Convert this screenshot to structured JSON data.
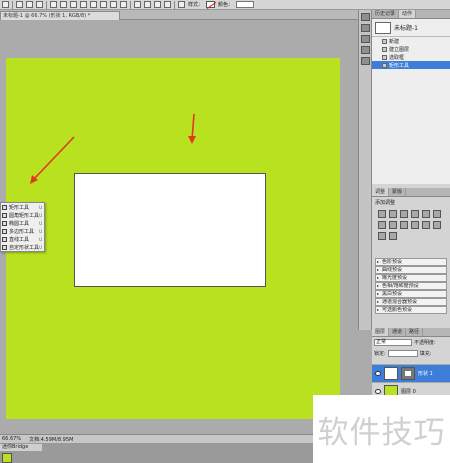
{
  "toolbar": {
    "style_label": "样式：",
    "color_label": "颜色："
  },
  "document": {
    "tab_title": "未标题-1 @ 66.7% (形状 1, RGB/8) *"
  },
  "flyout": {
    "items": [
      {
        "label": "矩形工具",
        "key": "U"
      },
      {
        "label": "圆角矩形工具",
        "key": "U"
      },
      {
        "label": "椭圆工具",
        "key": "U"
      },
      {
        "label": "多边形工具",
        "key": "U"
      },
      {
        "label": "直线工具",
        "key": "U"
      },
      {
        "label": "自定形状工具",
        "key": "U"
      }
    ]
  },
  "history": {
    "tabs": [
      "历史记录",
      "动作"
    ],
    "snapshot": "未标题-1",
    "items": [
      "新建",
      "建立图层",
      "选取框",
      "矩形工具"
    ],
    "selected_index": 3
  },
  "adjustments": {
    "tabs": [
      "调整",
      "蒙版"
    ],
    "title": "添加调整",
    "presets": [
      "色阶预设",
      "曲线预设",
      "曝光度预设",
      "色相/饱和度预设",
      "黑白预设",
      "通道混合器预设",
      "可选颜色预设"
    ]
  },
  "layers": {
    "tabs": [
      "图层",
      "通道",
      "路径"
    ],
    "blend_mode": "正常",
    "opacity_label": "不透明度:",
    "lock_label": "锁定:",
    "fill_label": "填充:",
    "rows": [
      {
        "name": "形状 1",
        "active": true
      },
      {
        "name": "图层 0",
        "active": false
      }
    ]
  },
  "status": {
    "zoom": "66.67%",
    "doc": "文档:4.59M/8.95M"
  },
  "bottom": {
    "tab": "迷你Bridge"
  },
  "watermark": {
    "text": "软件技巧"
  },
  "colors": {
    "canvas": "#b8e21f",
    "arrow": "#e03a1e",
    "selection": "#3d7fd8"
  }
}
